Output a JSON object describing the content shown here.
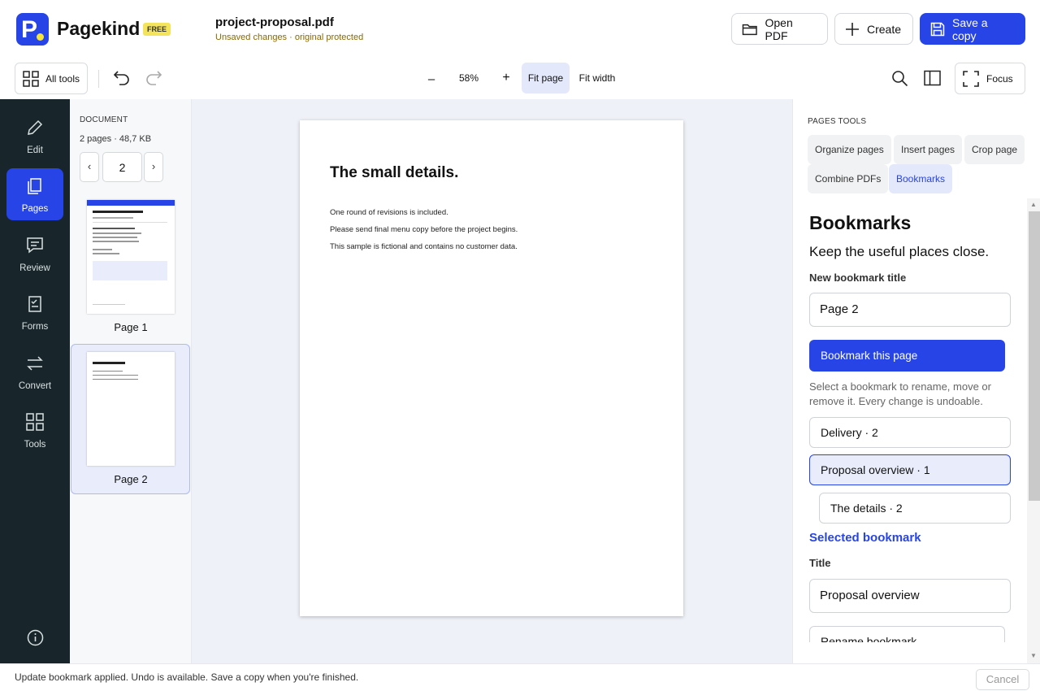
{
  "header": {
    "brand": "Pagekind",
    "badge": "FREE",
    "filename": "project-proposal.pdf",
    "file_status": "Unsaved changes · original protected",
    "open_pdf": "Open PDF",
    "create": "Create",
    "save_copy": "Save a copy"
  },
  "toolbar": {
    "all_tools": "All tools",
    "zoom_out": "–",
    "zoom": "58%",
    "zoom_in": "+",
    "fit_page": "Fit page",
    "fit_width": "Fit width",
    "focus": "Focus"
  },
  "rail": {
    "items": [
      {
        "label": "Edit",
        "icon": "pencil-icon"
      },
      {
        "label": "Pages",
        "icon": "pages-icon"
      },
      {
        "label": "Review",
        "icon": "comment-icon"
      },
      {
        "label": "Forms",
        "icon": "form-icon"
      },
      {
        "label": "Convert",
        "icon": "convert-icon"
      },
      {
        "label": "Tools",
        "icon": "grid-icon"
      }
    ]
  },
  "thumbs": {
    "section": "DOCUMENT",
    "meta": "2 pages · 48,7 KB",
    "prev": "‹",
    "next": "›",
    "current_page": "2",
    "pages": [
      {
        "label": "Page 1"
      },
      {
        "label": "Page 2"
      }
    ]
  },
  "document": {
    "title": "The small details.",
    "lines": [
      "One round of revisions is included.",
      "Please send final menu copy before the project begins.",
      "This sample is fictional and contains no customer data."
    ]
  },
  "panel": {
    "section": "PAGES TOOLS",
    "chips": [
      "Organize pages",
      "Insert pages",
      "Crop page",
      "Combine PDFs",
      "Bookmarks"
    ],
    "heading": "Bookmarks",
    "subheading": "Keep the useful places close.",
    "new_title_label": "New bookmark title",
    "new_title_value": "Page 2",
    "bookmark_btn": "Bookmark this page",
    "help": "Select a bookmark to rename, move or remove it. Every change is undoable.",
    "bookmarks": [
      {
        "label": "Delivery  ·  2"
      },
      {
        "label": "Proposal overview  ·  1"
      },
      {
        "label": "The details  ·  2"
      }
    ],
    "selected_heading": "Selected bookmark",
    "title_label": "Title",
    "title_value": "Proposal overview",
    "rename_btn": "Rename bookmark"
  },
  "status": {
    "message": "Update bookmark applied. Undo is available. Save a copy when you're finished.",
    "cancel": "Cancel"
  }
}
